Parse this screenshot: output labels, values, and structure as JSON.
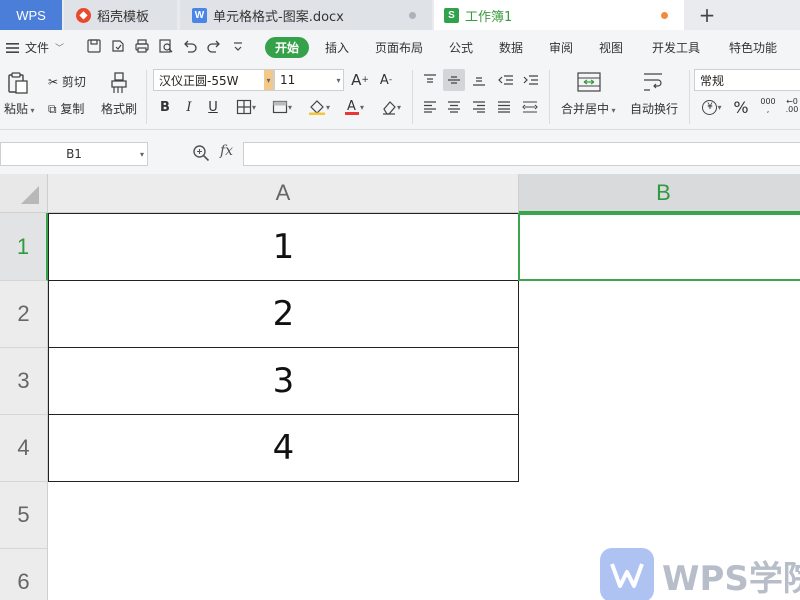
{
  "tabs": [
    {
      "label": "WPS"
    },
    {
      "label": "稻壳模板"
    },
    {
      "label": "单元格格式-图案.docx"
    },
    {
      "label": "工作簿1"
    }
  ],
  "menubar": {
    "file_label": "文件",
    "items": [
      "开始",
      "插入",
      "页面布局",
      "公式",
      "数据",
      "审阅",
      "视图",
      "开发工具",
      "特色功能"
    ]
  },
  "ribbon": {
    "paste": "粘贴",
    "cut": "剪切",
    "copy": "复制",
    "format_painter": "格式刷",
    "font_name": "汉仪正圆-55W",
    "font_size": "11",
    "merge_center": "合并居中",
    "wrap_text": "自动换行",
    "number_format": "常规"
  },
  "formula_bar": {
    "name_box": "B1",
    "fx": "fx",
    "formula": ""
  },
  "sheet": {
    "columns": [
      "A",
      "B"
    ],
    "active_column": "B",
    "rows": [
      "1",
      "2",
      "3",
      "4",
      "5",
      "6"
    ],
    "active_row": "1",
    "cells_A": [
      "1",
      "2",
      "3",
      "4"
    ]
  },
  "watermark": {
    "text": "WPS学院"
  },
  "colors": {
    "accent": "#35a148",
    "wps_blue": "#4b7ed8",
    "selection": "#3da64d"
  }
}
